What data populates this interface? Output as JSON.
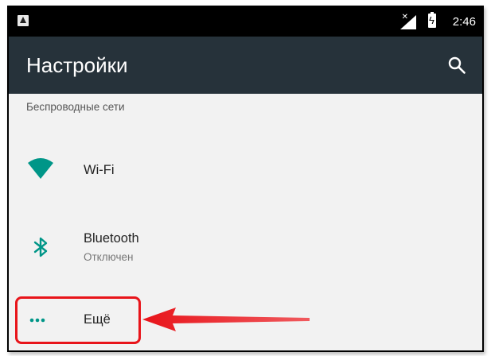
{
  "status_bar": {
    "time": "2:46",
    "notification_icon": "app-notification-icon",
    "signal_icon": "signal-no-data-icon",
    "battery_icon": "battery-charging-icon"
  },
  "app_bar": {
    "title": "Настройки",
    "search_icon": "search-icon",
    "background_color": "#26323a"
  },
  "section": {
    "header": "Беспроводные сети"
  },
  "items": [
    {
      "icon": "wifi-icon",
      "title": "Wi-Fi"
    },
    {
      "icon": "bluetooth-icon",
      "title": "Bluetooth",
      "subtitle": "Отключен"
    },
    {
      "icon": "more-dots-icon",
      "title": "Ещё"
    }
  ],
  "accent_color": "#009688",
  "annotation": {
    "highlight_color": "#e8141a"
  }
}
